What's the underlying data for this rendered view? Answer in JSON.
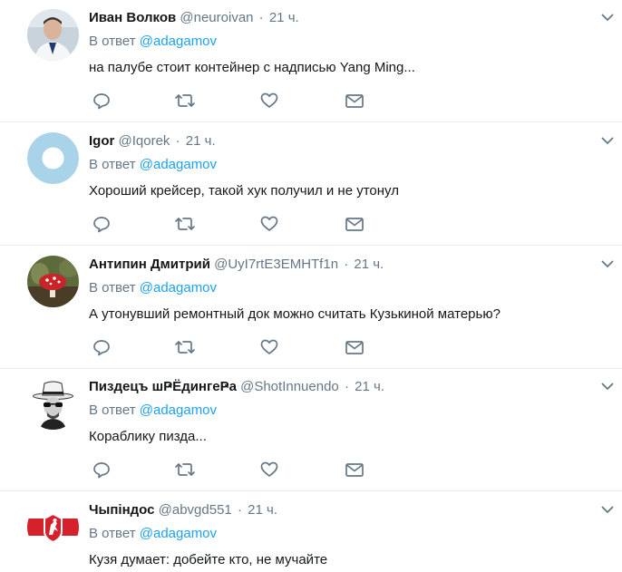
{
  "tweets": [
    {
      "name": "Иван Волков",
      "handle": "@neuroivan",
      "time": "21 ч.",
      "reply_prefix": "В ответ",
      "reply_mention": "@adagamov",
      "text": "на палубе стоит контейнер с надписью Yang Ming..."
    },
    {
      "name": "Igor",
      "handle": "@Iqorek",
      "time": "21 ч.",
      "reply_prefix": "В ответ",
      "reply_mention": "@adagamov",
      "text": "Хороший крейсер, такой хук получил и не утонул"
    },
    {
      "name": "Антипин Дмитрий",
      "handle": "@UyI7rtE3EMHTf1n",
      "time": "21 ч.",
      "reply_prefix": "В ответ",
      "reply_mention": "@adagamov",
      "text": "А утонувший ремонтный док можно считать Кузькиной матерью?"
    },
    {
      "name": "Пиздецъ шҎЁдингеҎа",
      "handle": "@ShotInnuendo",
      "time": "21 ч.",
      "reply_prefix": "В ответ",
      "reply_mention": "@adagamov",
      "text": "Кораблику пизда..."
    },
    {
      "name": "Чыпіндос",
      "handle": "@abvgd551",
      "time": "21 ч.",
      "reply_prefix": "В ответ",
      "reply_mention": "@adagamov",
      "text": "Кузя думает: добейте кто, не мучайте"
    }
  ],
  "icons": {
    "reply": "reply-icon",
    "retweet": "retweet-icon",
    "like": "heart-icon",
    "dm": "envelope-icon",
    "more": "chevron-down-icon"
  },
  "colors": {
    "mention": "#1da1f2",
    "secondary": "#657786",
    "divider": "#e6ecf0"
  }
}
